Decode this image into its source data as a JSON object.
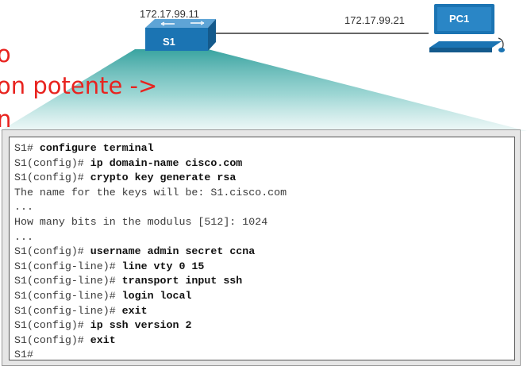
{
  "topology": {
    "switch_ip": "172.17.99.11",
    "switch_label": "S1",
    "pc_ip": "172.17.99.21",
    "pc_label": "PC1"
  },
  "overlay_text": {
    "line1": "o",
    "line2": "on potente ->",
    "line3": "n"
  },
  "colors": {
    "device_blue": "#1b74b3",
    "overlay_red": "#e8231f",
    "funnel_teal": "#3aa9a6"
  },
  "terminal": {
    "lines": [
      {
        "prompt": "S1# ",
        "command": "configure terminal",
        "output": ""
      },
      {
        "prompt": "S1(config)# ",
        "command": "ip domain-name cisco.com",
        "output": ""
      },
      {
        "prompt": "S1(config)# ",
        "command": "crypto key generate rsa",
        "output": ""
      },
      {
        "prompt": "",
        "command": "",
        "output": "The name for the keys will be: S1.cisco.com"
      },
      {
        "prompt": "",
        "command": "",
        "output": "..."
      },
      {
        "prompt": "",
        "command": "",
        "output": "How many bits in the modulus [512]: 1024"
      },
      {
        "prompt": "",
        "command": "",
        "output": "..."
      },
      {
        "prompt": "S1(config)# ",
        "command": "username admin secret ccna",
        "output": ""
      },
      {
        "prompt": "S1(config-line)# ",
        "command": "line vty 0 15",
        "output": ""
      },
      {
        "prompt": "S1(config-line)# ",
        "command": "transport input ssh",
        "output": ""
      },
      {
        "prompt": "S1(config-line)# ",
        "command": "login local",
        "output": ""
      },
      {
        "prompt": "S1(config-line)# ",
        "command": "exit",
        "output": ""
      },
      {
        "prompt": "S1(config)# ",
        "command": "ip ssh version 2",
        "output": ""
      },
      {
        "prompt": "S1(config)# ",
        "command": "exit",
        "output": ""
      },
      {
        "prompt": "S1#",
        "command": "",
        "output": ""
      }
    ]
  }
}
